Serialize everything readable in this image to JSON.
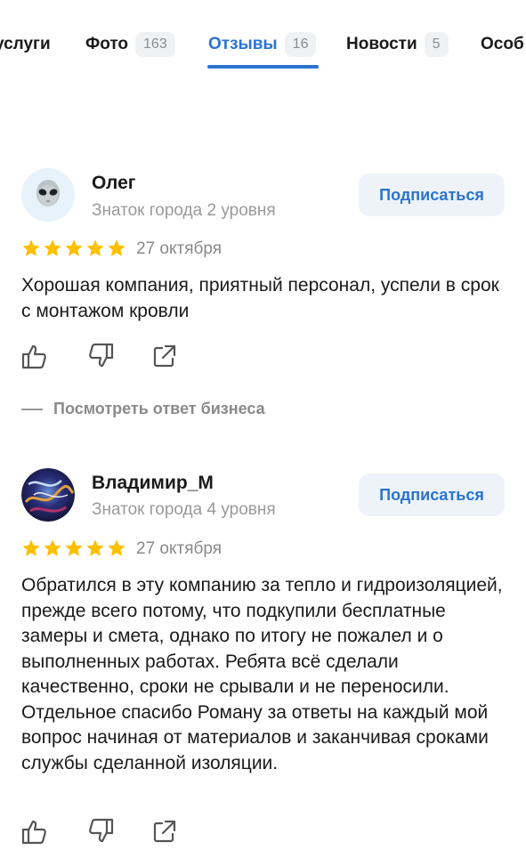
{
  "tabs": [
    {
      "label": "услуги",
      "count": null
    },
    {
      "label": "Фото",
      "count": "163"
    },
    {
      "label": "Отзывы",
      "count": "16"
    },
    {
      "label": "Новости",
      "count": "5"
    },
    {
      "label": "Особ",
      "count": null
    }
  ],
  "reviews": [
    {
      "author": "Олег",
      "level": "Знаток города 2 уровня",
      "subscribe_label": "Подписаться",
      "rating": 5,
      "date": "27 октября",
      "text": "Хорошая компания, приятный персонал, успели в срок с монтажом кровли",
      "business_reply_label": "Посмотреть ответ бизнеса",
      "avatar_icon": "alien-emoji-icon"
    },
    {
      "author": "Владимир_М",
      "level": "Знаток города 4 уровня",
      "subscribe_label": "Подписаться",
      "rating": 5,
      "date": "27 октября",
      "text": "Обратился в эту компанию за тепло и гидроизоляцией, прежде всего потому, что подкупили бесплатные замеры и смета, однако по итогу не пожалел и о выполненных работах. Ребята всё сделали качественно, сроки не срывали и не переносили. Отдельное спасибо Роману за ответы на каждый мой вопрос начиная от материалов и заканчивая сроками службы сделанной изоляции.",
      "avatar_icon": "abstract-photo-avatar"
    }
  ],
  "colors": {
    "accent": "#2a73d0",
    "star": "#fcc000",
    "muted": "#8a8a8a",
    "badge_bg": "#f0f1f3",
    "button_bg": "#eef3fa"
  }
}
